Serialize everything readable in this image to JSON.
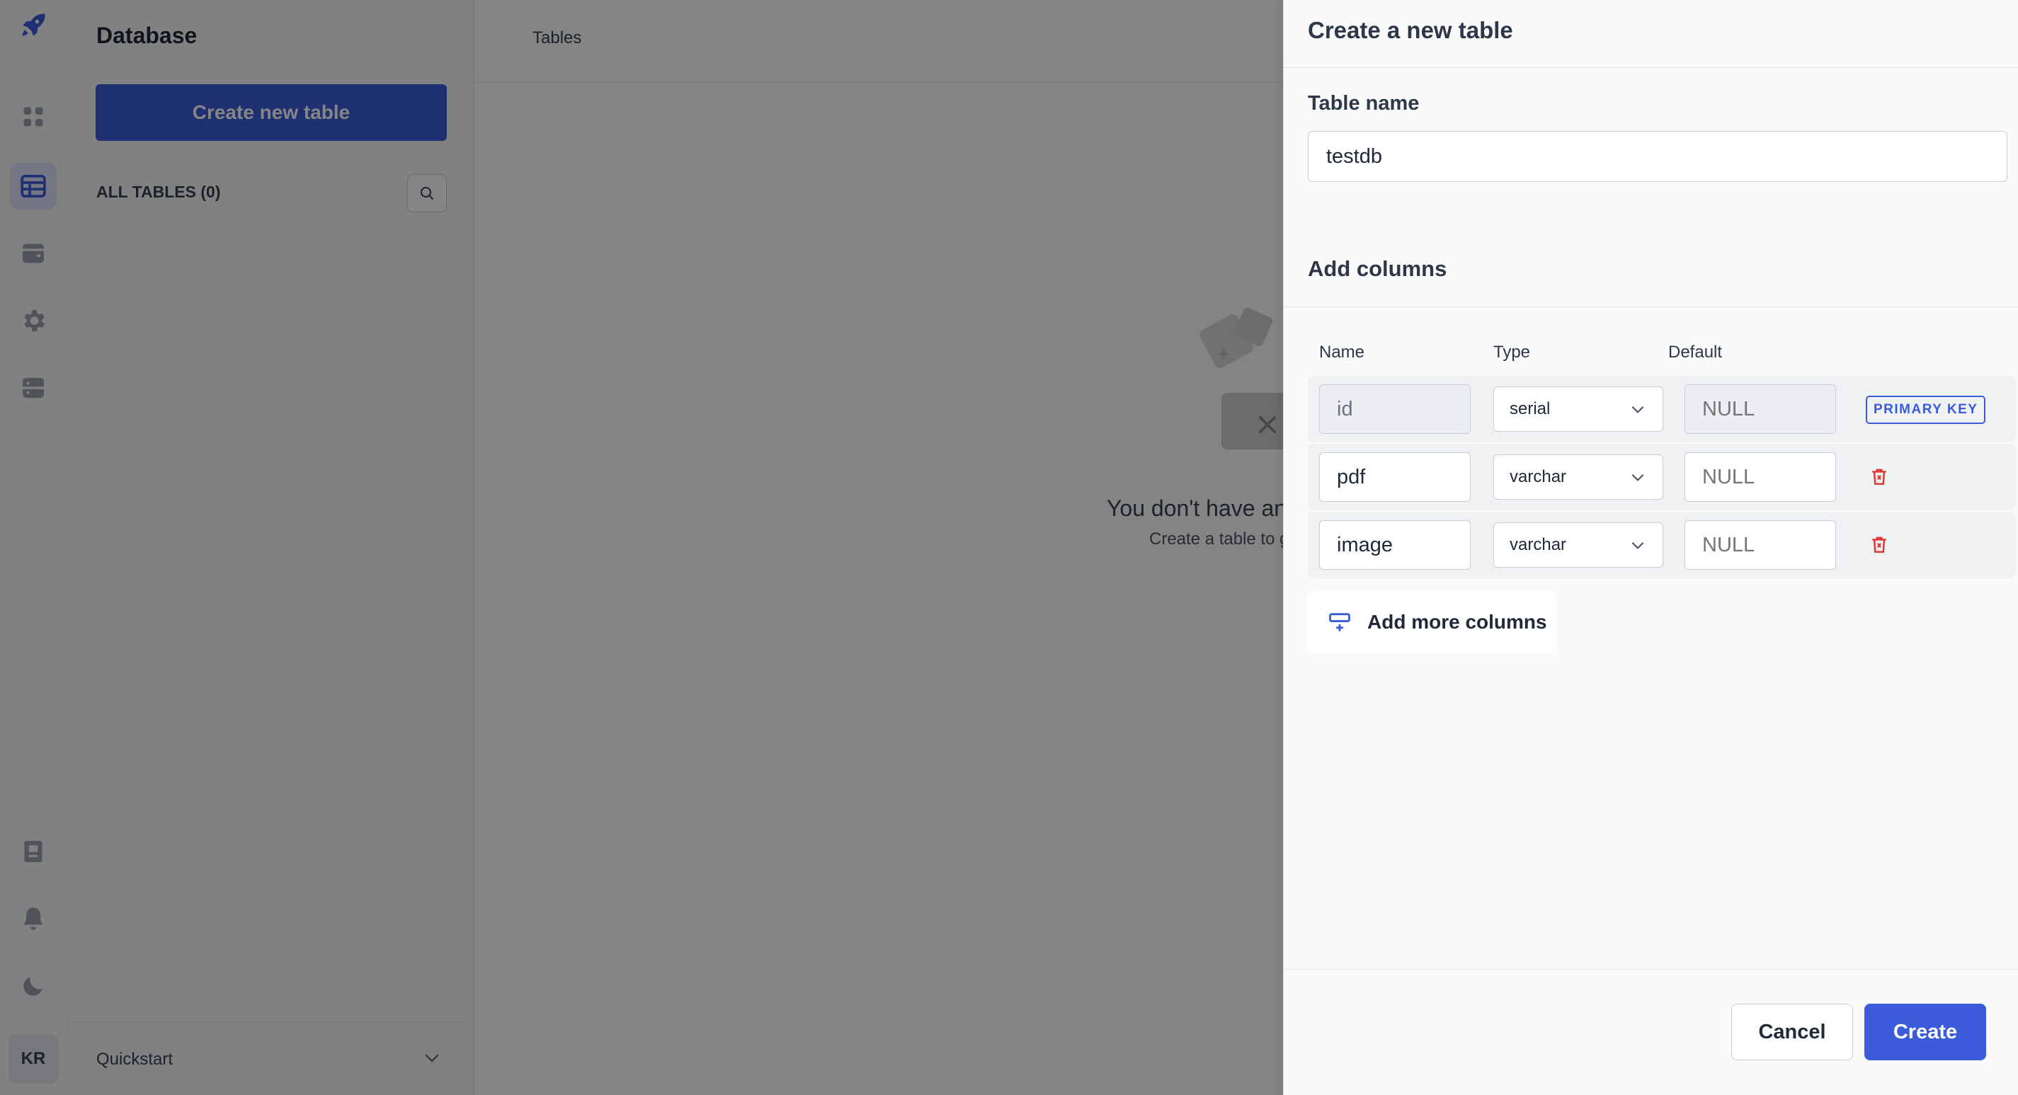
{
  "sidebar": {
    "nav_icons": [
      "grid-icon",
      "table-icon",
      "storage-icon",
      "gear-icon",
      "server-icon"
    ],
    "bottom_icons": [
      "docs-icon",
      "bell-icon",
      "moon-icon"
    ],
    "avatar_initials": "KR"
  },
  "database_panel": {
    "title": "Database",
    "create_button": "Create new table",
    "all_tables_label": "ALL TABLES (0)",
    "quickstart_label": "Quickstart"
  },
  "main": {
    "tab_label": "Tables",
    "empty_title": "You don't have an",
    "empty_subtitle": "Create a table to g"
  },
  "drawer": {
    "title": "Create a new table",
    "table_name_label": "Table name",
    "table_name_value": "testdb",
    "add_columns_label": "Add columns",
    "column_headers": {
      "name": "Name",
      "type": "Type",
      "default": "Default"
    },
    "columns": [
      {
        "name": "id",
        "type": "serial",
        "default_placeholder": "NULL",
        "primary_key_label": "PRIMARY KEY"
      },
      {
        "name": "pdf",
        "type": "varchar",
        "default_placeholder": "NULL"
      },
      {
        "name": "image",
        "type": "varchar",
        "default_placeholder": "NULL"
      }
    ],
    "add_more_label": "Add more columns",
    "cancel_label": "Cancel",
    "create_label": "Create"
  },
  "colors": {
    "accent": "#3b5bdb",
    "delete": "#e03131",
    "overlay": "rgba(0,0,0,0.48)"
  }
}
